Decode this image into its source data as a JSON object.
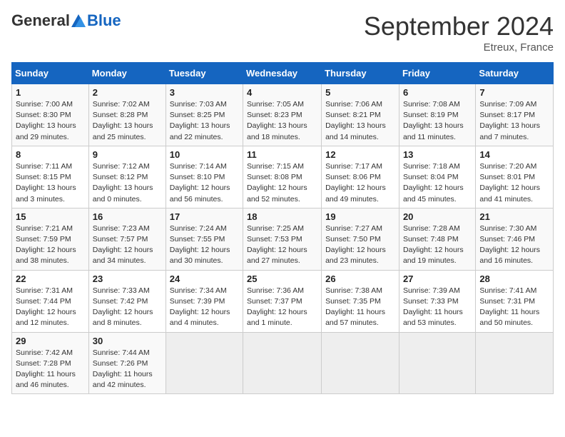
{
  "header": {
    "logo_general": "General",
    "logo_blue": "Blue",
    "month_title": "September 2024",
    "location": "Etreux, France"
  },
  "weekdays": [
    "Sunday",
    "Monday",
    "Tuesday",
    "Wednesday",
    "Thursday",
    "Friday",
    "Saturday"
  ],
  "weeks": [
    [
      {
        "day": "1",
        "sunrise": "Sunrise: 7:00 AM",
        "sunset": "Sunset: 8:30 PM",
        "daylight": "Daylight: 13 hours and 29 minutes."
      },
      {
        "day": "2",
        "sunrise": "Sunrise: 7:02 AM",
        "sunset": "Sunset: 8:28 PM",
        "daylight": "Daylight: 13 hours and 25 minutes."
      },
      {
        "day": "3",
        "sunrise": "Sunrise: 7:03 AM",
        "sunset": "Sunset: 8:25 PM",
        "daylight": "Daylight: 13 hours and 22 minutes."
      },
      {
        "day": "4",
        "sunrise": "Sunrise: 7:05 AM",
        "sunset": "Sunset: 8:23 PM",
        "daylight": "Daylight: 13 hours and 18 minutes."
      },
      {
        "day": "5",
        "sunrise": "Sunrise: 7:06 AM",
        "sunset": "Sunset: 8:21 PM",
        "daylight": "Daylight: 13 hours and 14 minutes."
      },
      {
        "day": "6",
        "sunrise": "Sunrise: 7:08 AM",
        "sunset": "Sunset: 8:19 PM",
        "daylight": "Daylight: 13 hours and 11 minutes."
      },
      {
        "day": "7",
        "sunrise": "Sunrise: 7:09 AM",
        "sunset": "Sunset: 8:17 PM",
        "daylight": "Daylight: 13 hours and 7 minutes."
      }
    ],
    [
      {
        "day": "8",
        "sunrise": "Sunrise: 7:11 AM",
        "sunset": "Sunset: 8:15 PM",
        "daylight": "Daylight: 13 hours and 3 minutes."
      },
      {
        "day": "9",
        "sunrise": "Sunrise: 7:12 AM",
        "sunset": "Sunset: 8:12 PM",
        "daylight": "Daylight: 13 hours and 0 minutes."
      },
      {
        "day": "10",
        "sunrise": "Sunrise: 7:14 AM",
        "sunset": "Sunset: 8:10 PM",
        "daylight": "Daylight: 12 hours and 56 minutes."
      },
      {
        "day": "11",
        "sunrise": "Sunrise: 7:15 AM",
        "sunset": "Sunset: 8:08 PM",
        "daylight": "Daylight: 12 hours and 52 minutes."
      },
      {
        "day": "12",
        "sunrise": "Sunrise: 7:17 AM",
        "sunset": "Sunset: 8:06 PM",
        "daylight": "Daylight: 12 hours and 49 minutes."
      },
      {
        "day": "13",
        "sunrise": "Sunrise: 7:18 AM",
        "sunset": "Sunset: 8:04 PM",
        "daylight": "Daylight: 12 hours and 45 minutes."
      },
      {
        "day": "14",
        "sunrise": "Sunrise: 7:20 AM",
        "sunset": "Sunset: 8:01 PM",
        "daylight": "Daylight: 12 hours and 41 minutes."
      }
    ],
    [
      {
        "day": "15",
        "sunrise": "Sunrise: 7:21 AM",
        "sunset": "Sunset: 7:59 PM",
        "daylight": "Daylight: 12 hours and 38 minutes."
      },
      {
        "day": "16",
        "sunrise": "Sunrise: 7:23 AM",
        "sunset": "Sunset: 7:57 PM",
        "daylight": "Daylight: 12 hours and 34 minutes."
      },
      {
        "day": "17",
        "sunrise": "Sunrise: 7:24 AM",
        "sunset": "Sunset: 7:55 PM",
        "daylight": "Daylight: 12 hours and 30 minutes."
      },
      {
        "day": "18",
        "sunrise": "Sunrise: 7:25 AM",
        "sunset": "Sunset: 7:53 PM",
        "daylight": "Daylight: 12 hours and 27 minutes."
      },
      {
        "day": "19",
        "sunrise": "Sunrise: 7:27 AM",
        "sunset": "Sunset: 7:50 PM",
        "daylight": "Daylight: 12 hours and 23 minutes."
      },
      {
        "day": "20",
        "sunrise": "Sunrise: 7:28 AM",
        "sunset": "Sunset: 7:48 PM",
        "daylight": "Daylight: 12 hours and 19 minutes."
      },
      {
        "day": "21",
        "sunrise": "Sunrise: 7:30 AM",
        "sunset": "Sunset: 7:46 PM",
        "daylight": "Daylight: 12 hours and 16 minutes."
      }
    ],
    [
      {
        "day": "22",
        "sunrise": "Sunrise: 7:31 AM",
        "sunset": "Sunset: 7:44 PM",
        "daylight": "Daylight: 12 hours and 12 minutes."
      },
      {
        "day": "23",
        "sunrise": "Sunrise: 7:33 AM",
        "sunset": "Sunset: 7:42 PM",
        "daylight": "Daylight: 12 hours and 8 minutes."
      },
      {
        "day": "24",
        "sunrise": "Sunrise: 7:34 AM",
        "sunset": "Sunset: 7:39 PM",
        "daylight": "Daylight: 12 hours and 4 minutes."
      },
      {
        "day": "25",
        "sunrise": "Sunrise: 7:36 AM",
        "sunset": "Sunset: 7:37 PM",
        "daylight": "Daylight: 12 hours and 1 minute."
      },
      {
        "day": "26",
        "sunrise": "Sunrise: 7:38 AM",
        "sunset": "Sunset: 7:35 PM",
        "daylight": "Daylight: 11 hours and 57 minutes."
      },
      {
        "day": "27",
        "sunrise": "Sunrise: 7:39 AM",
        "sunset": "Sunset: 7:33 PM",
        "daylight": "Daylight: 11 hours and 53 minutes."
      },
      {
        "day": "28",
        "sunrise": "Sunrise: 7:41 AM",
        "sunset": "Sunset: 7:31 PM",
        "daylight": "Daylight: 11 hours and 50 minutes."
      }
    ],
    [
      {
        "day": "29",
        "sunrise": "Sunrise: 7:42 AM",
        "sunset": "Sunset: 7:28 PM",
        "daylight": "Daylight: 11 hours and 46 minutes."
      },
      {
        "day": "30",
        "sunrise": "Sunrise: 7:44 AM",
        "sunset": "Sunset: 7:26 PM",
        "daylight": "Daylight: 11 hours and 42 minutes."
      },
      null,
      null,
      null,
      null,
      null
    ]
  ]
}
